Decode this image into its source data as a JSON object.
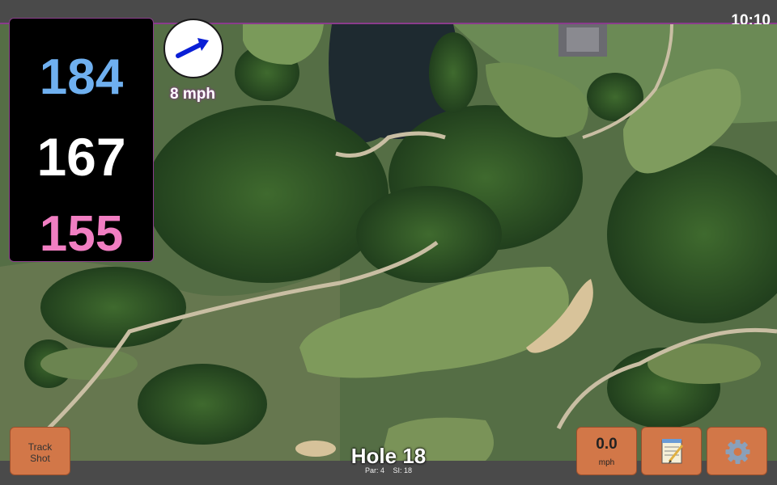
{
  "status_bar": {
    "time": "10:10"
  },
  "distances": {
    "back": "184",
    "middle": "167",
    "front": "155"
  },
  "wind": {
    "speed_label": "8 mph",
    "direction_icon": "wind-arrow-icon"
  },
  "hole": {
    "title": "Hole 18",
    "par_label": "Par: 4",
    "si_label": "SI: 18"
  },
  "buttons": {
    "track_shot_line1": "Track",
    "track_shot_line2": "Shot",
    "speed_value": "0.0",
    "speed_unit": "mph",
    "notes_icon": "notepad-icon",
    "settings_icon": "gear-icon"
  },
  "colors": {
    "back_distance": "#6fb0f0",
    "middle_distance": "#ffffff",
    "front_distance": "#f17ec2",
    "button": "#d27748",
    "accent_border": "#8a3c8c"
  }
}
